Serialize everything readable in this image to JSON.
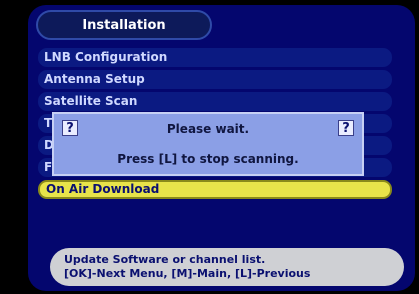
{
  "header": {
    "title": "Installation"
  },
  "menu": {
    "items": [
      {
        "label": "LNB Configuration"
      },
      {
        "label": "Antenna Setup"
      },
      {
        "label": "Satellite Scan"
      },
      {
        "label": "T"
      },
      {
        "label": "D"
      },
      {
        "label": "F"
      },
      {
        "label": "On Air Download"
      }
    ],
    "selected_index": 6
  },
  "dialog": {
    "icon_left": "?",
    "icon_right": "?",
    "title": "Please wait.",
    "message": "Press [L] to stop scanning."
  },
  "help": {
    "line1": "Update Software or channel list.",
    "line2": "[OK]-Next Menu, [M]-Main, [L]-Previous"
  },
  "colors": {
    "background": "#04066e",
    "menu_item": "#0b1a82",
    "selected": "#e8e44a",
    "dialog": "#8b9fe6",
    "help_bar": "#cfd0d4"
  }
}
